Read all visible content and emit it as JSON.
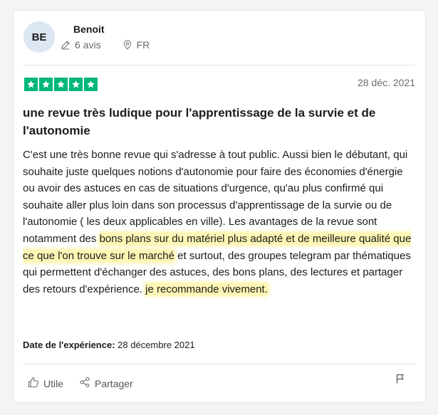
{
  "reviewer": {
    "initials": "BE",
    "name": "Benoit",
    "reviews_count": "6 avis",
    "country": "FR",
    "avatar_bg": "#dde7f4"
  },
  "review": {
    "rating": 5,
    "rating_color": "#00b67a",
    "date": "28 déc. 2021",
    "title": "une revue très ludique pour l'apprentissage de la survie et de l'autonomie",
    "body_part1": "C'est une très bonne revue qui s'adresse à tout public. Aussi bien le débutant, qui souhaite juste quelques notions d'autonomie pour faire des économies d'énergie ou avoir des astuces en cas de situations d'urgence, qu'au plus confirmé qui souhaite aller plus loin dans son processus d'apprentissage de la survie ou de l'autonomie ( les deux applicables en ville). Les avantages de la revue sont notamment des ",
    "body_highlight1": "bons plans sur du matériel plus adapté et de meilleure qualité que ce que l'on trouve sur le marché",
    "body_part2": " et surtout, des groupes telegram par thématiques qui permettent d'échanger des astuces, des bons plans, des lectures et partager des retours d'expérience. ",
    "body_highlight2": "je recommande vivement.",
    "highlight_color": "#fdf6b4",
    "experience_label": "Date de l'expérience:",
    "experience_date": "28 décembre 2021"
  },
  "actions": {
    "useful_label": "Utile",
    "share_label": "Partager"
  },
  "icons": {
    "reviews": "pencil-icon",
    "location": "location-pin-icon",
    "useful": "thumbs-up-icon",
    "share": "share-icon",
    "report": "flag-icon",
    "star": "star-icon"
  }
}
